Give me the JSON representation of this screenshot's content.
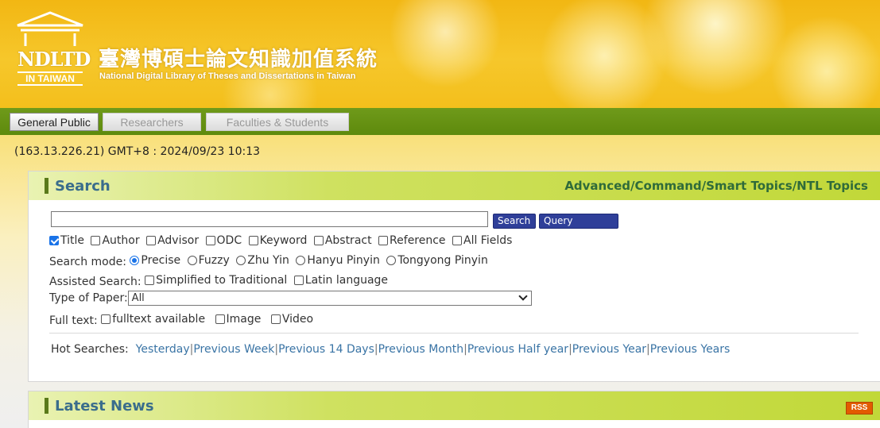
{
  "header": {
    "logo_text": "NDLTD",
    "logo_sub": "IN TAIWAN",
    "title_zh": "臺灣博碩士論文知識加值系統",
    "title_en": "National Digital Library of Theses and Dissertations in Taiwan"
  },
  "tabs": [
    {
      "label": "General Public",
      "active": true
    },
    {
      "label": "Researchers",
      "active": false
    },
    {
      "label": "Faculties & Students",
      "active": false
    }
  ],
  "status_line": "(163.13.226.21) GMT+8 : 2024/09/23 10:13",
  "search_panel": {
    "title": "Search",
    "advanced_link": "Advanced/Command/Smart Topics/NTL Topics",
    "query_value": "",
    "search_button": "Search",
    "expand_button": "Query expansion",
    "fields": [
      {
        "label": "Title",
        "checked": true
      },
      {
        "label": "Author",
        "checked": false
      },
      {
        "label": "Advisor",
        "checked": false
      },
      {
        "label": "ODC",
        "checked": false
      },
      {
        "label": "Keyword",
        "checked": false
      },
      {
        "label": "Abstract",
        "checked": false
      },
      {
        "label": "Reference",
        "checked": false
      },
      {
        "label": "All Fields",
        "checked": false
      }
    ],
    "mode_label": "Search mode:",
    "modes": [
      {
        "label": "Precise",
        "checked": true
      },
      {
        "label": "Fuzzy",
        "checked": false
      },
      {
        "label": "Zhu Yin",
        "checked": false
      },
      {
        "label": "Hanyu Pinyin",
        "checked": false
      },
      {
        "label": "Tongyong Pinyin",
        "checked": false
      }
    ],
    "assisted_label": "Assisted Search:",
    "assisted": [
      {
        "label": "Simplified to Traditional",
        "checked": false
      },
      {
        "label": "Latin language",
        "checked": false
      }
    ],
    "paper_type_label": "Type of Paper:",
    "paper_type_value": "All",
    "fulltext_label": "Full text:",
    "fulltext": [
      {
        "label": "fulltext available",
        "checked": false
      },
      {
        "label": "Image",
        "checked": false
      },
      {
        "label": "Video",
        "checked": false
      }
    ],
    "hot_label": "Hot Searches:",
    "hot_links": [
      "Yesterday",
      "Previous Week",
      "Previous 14 Days",
      "Previous Month",
      "Previous Half year",
      "Previous Year",
      "Previous Years"
    ]
  },
  "news_panel": {
    "title": "Latest News",
    "rss_label": "RSS"
  },
  "colors": {
    "tab_bar": "#5e8a0d",
    "panel_title": "#3a6d8c",
    "link": "#3a74a5",
    "button": "#2f3f99",
    "rss": "#e35b00"
  }
}
